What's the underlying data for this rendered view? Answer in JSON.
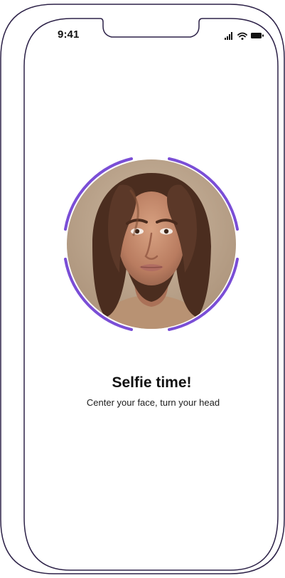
{
  "status_bar": {
    "time": "9:41",
    "icons": [
      "cellular-signal-icon",
      "wifi-icon",
      "battery-icon"
    ]
  },
  "selfie": {
    "title": "Selfie time!",
    "subtitle": "Center your face, turn your head",
    "ring_color": "#7a4ed6"
  },
  "colors": {
    "frame_outline": "#2d2248",
    "background": "#ffffff"
  }
}
